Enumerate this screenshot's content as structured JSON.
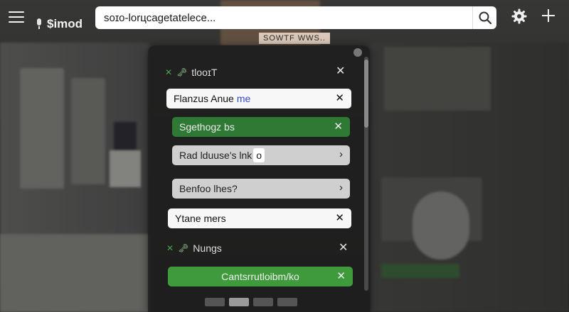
{
  "brand": {
    "name": "$imod"
  },
  "search": {
    "value": "soɪo-lorцcagetatelece..."
  },
  "hint": "SOWTF WWS..",
  "panel": {
    "sections": [
      {
        "header": "tlooɪT",
        "items": [
          {
            "label": "Flanzus Anue",
            "suffix": "me",
            "style": "white",
            "end": "✕"
          },
          {
            "label": "Sgethogz bs",
            "style": "green",
            "end": "✕"
          },
          {
            "label": "Rad lduuse's lnk",
            "chip": "o",
            "style": "grey",
            "end": "›"
          },
          {
            "label": "Benfoo lhes?",
            "style": "grey",
            "end": "›"
          },
          {
            "label": "Ytane mers",
            "style": "white",
            "end": "✕"
          }
        ]
      },
      {
        "header": "Nungs",
        "items": [
          {
            "label": "Cantsrrutloibm/ko",
            "style": "bright",
            "end": "✕"
          }
        ]
      }
    ]
  },
  "colors": {
    "accent_green": "#3f9a3c",
    "dark_green": "#2e7a34",
    "panel_bg": "#1e1e1e"
  },
  "icons": [
    "menu-icon",
    "mic-icon",
    "search-icon",
    "gear-icon",
    "plus-icon",
    "close-icon",
    "chevron-right-icon"
  ]
}
